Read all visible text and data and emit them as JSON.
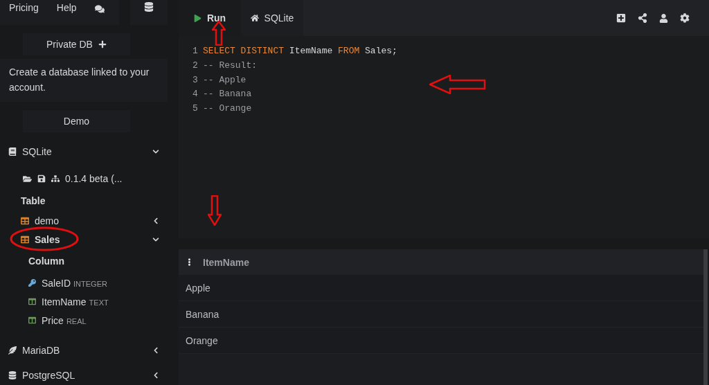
{
  "top_nav": [
    {
      "label": "Pricing"
    },
    {
      "label": "Help"
    }
  ],
  "private_db": {
    "label": "Private DB"
  },
  "description": "Create a database linked to your account.",
  "demo": {
    "label": "Demo"
  },
  "databases": [
    {
      "name": "SQLite",
      "kind": "sqlite",
      "expanded": true,
      "version": "0.1.4 beta (...",
      "tables_heading": "Table",
      "tables": [
        {
          "name": "demo",
          "expanded": false
        },
        {
          "name": "Sales",
          "expanded": true,
          "columns_heading": "Column",
          "columns": [
            {
              "name": "SaleID",
              "type": "INTEGER",
              "kind": "key"
            },
            {
              "name": "ItemName",
              "type": "TEXT",
              "kind": "column"
            },
            {
              "name": "Price",
              "type": "REAL",
              "kind": "column"
            }
          ]
        }
      ]
    },
    {
      "name": "MariaDB",
      "kind": "mariadb",
      "expanded": false
    },
    {
      "name": "PostgreSQL",
      "kind": "postgres",
      "expanded": false
    }
  ],
  "tabs": [
    {
      "label": "Run",
      "kind": "run",
      "selected": true
    },
    {
      "label": "SQLite",
      "kind": "home",
      "selected": false
    }
  ],
  "code": [
    {
      "number": "1",
      "tokens": [
        {
          "text": "SELECT DISTINCT",
          "kind": "keyword"
        },
        {
          "text": " ItemName ",
          "kind": "plain"
        },
        {
          "text": "FROM",
          "kind": "keyword"
        },
        {
          "text": " Sales;",
          "kind": "plain"
        }
      ]
    },
    {
      "number": "2",
      "tokens": [
        {
          "text": "-- Result:",
          "kind": "comment"
        }
      ]
    },
    {
      "number": "3",
      "tokens": [
        {
          "text": "-- Apple",
          "kind": "comment"
        }
      ]
    },
    {
      "number": "4",
      "tokens": [
        {
          "text": "-- Banana",
          "kind": "comment"
        }
      ]
    },
    {
      "number": "5",
      "tokens": [
        {
          "text": "-- Orange",
          "kind": "comment"
        }
      ]
    }
  ],
  "result": {
    "columns": [
      "ItemName"
    ],
    "rows": [
      [
        "Apple"
      ],
      [
        "Banana"
      ],
      [
        "Orange"
      ]
    ]
  }
}
